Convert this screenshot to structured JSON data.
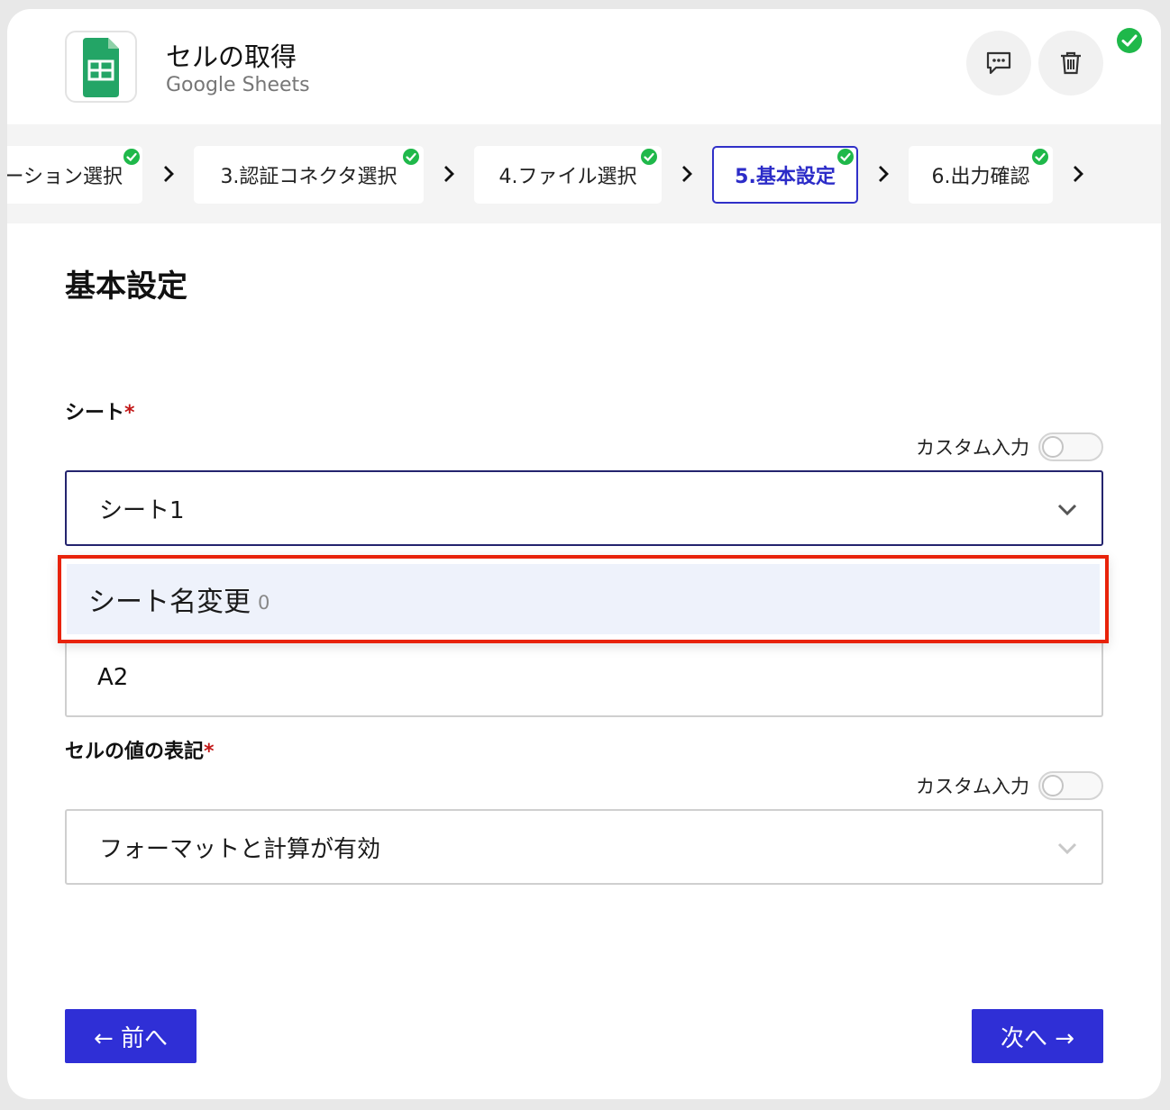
{
  "header": {
    "title": "セルの取得",
    "subtitle": "Google Sheets",
    "app_icon": "google-sheets-icon",
    "comment_icon": "comment-icon",
    "delete_icon": "trash-icon",
    "status_icon": "check-circle-icon"
  },
  "steps": [
    {
      "label": "ケーション選択",
      "done": true,
      "active": false
    },
    {
      "label": "3.認証コネクタ選択",
      "done": true,
      "active": false
    },
    {
      "label": "4.ファイル選択",
      "done": true,
      "active": false
    },
    {
      "label": "5.基本設定",
      "done": true,
      "active": true
    },
    {
      "label": "6.出力確認",
      "done": true,
      "active": false
    }
  ],
  "main": {
    "section_title": "基本設定",
    "sheet_field": {
      "label": "シート",
      "required_mark": "*",
      "custom_input_label": "カスタム入力",
      "custom_input_on": false,
      "selected_value": "シート1"
    },
    "sheet_dropdown": {
      "options": [
        {
          "label": "シート名変更",
          "count": "0"
        }
      ]
    },
    "cell_field": {
      "value": "A2"
    },
    "value_format_field": {
      "label": "セルの値の表記",
      "required_mark": "*",
      "custom_input_label": "カスタム入力",
      "custom_input_on": false,
      "selected_value": "フォーマットと計算が有効"
    }
  },
  "footer": {
    "prev_label": "← 前へ",
    "next_label": "次へ →"
  },
  "colors": {
    "accent": "#2f2fd6",
    "active_step_border": "#3030c8",
    "success": "#1fb84a",
    "highlight_border": "#e8230a",
    "required": "#c21818",
    "sheets_green": "#23a566"
  }
}
